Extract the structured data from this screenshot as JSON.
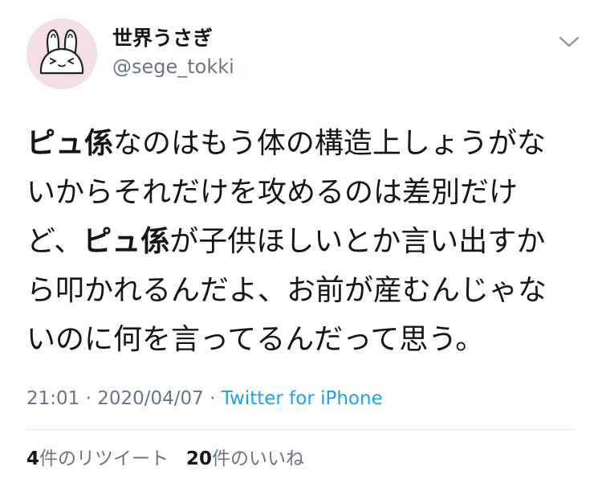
{
  "author": {
    "display_name": "世界うさぎ",
    "handle": "@sege_tokki",
    "avatar_icon": "rabbit-avatar-icon"
  },
  "more_icon": "chevron-down-icon",
  "tweet": {
    "lines": [
      [
        {
          "text": "ピュ係",
          "strong": true
        },
        {
          "text": "なのはもう体の構造上しょうがな",
          "strong": false
        }
      ],
      [
        {
          "text": "いからそれだけを攻めるのは差別だけ",
          "strong": false
        }
      ],
      [
        {
          "text": "ど、",
          "strong": false
        },
        {
          "text": "ピュ係",
          "strong": true
        },
        {
          "text": "が子供ほしいとか言い出すか",
          "strong": false
        }
      ],
      [
        {
          "text": "ら叩かれるんだよ、お前が産むんじゃな",
          "strong": false
        }
      ],
      [
        {
          "text": "いのに何を言ってるんだって思う。",
          "strong": false
        }
      ]
    ]
  },
  "meta": {
    "time": "21:01",
    "separator": " · ",
    "date": "2020/04/07",
    "source": "Twitter for iPhone"
  },
  "stats": {
    "retweet_count": "4",
    "retweet_label": "件のリツイート",
    "like_count": "20",
    "like_label": "件のいいね"
  },
  "colors": {
    "text": "#14171a",
    "secondary": "#657786",
    "link": "#1da1f2",
    "avatar_bg": "#f3dfe2",
    "divider": "#e1e8ed"
  }
}
